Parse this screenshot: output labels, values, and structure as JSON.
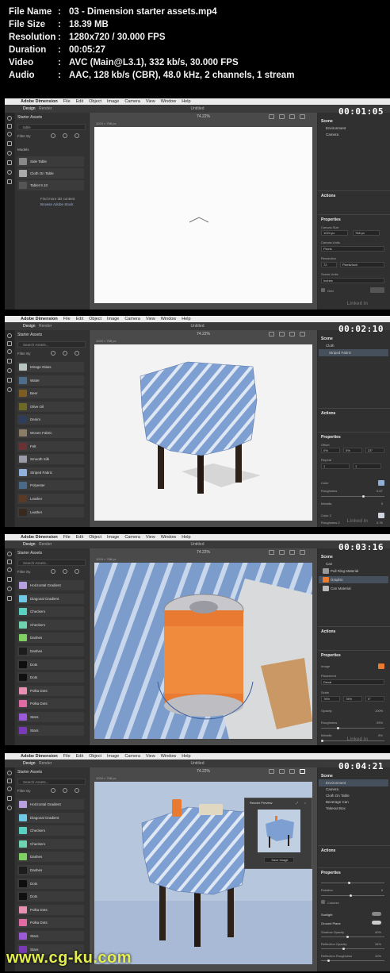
{
  "media_info": [
    {
      "key": "File Name",
      "value": "03 - Dimension starter assets.mp4"
    },
    {
      "key": "File Size",
      "value": "18.39 MB"
    },
    {
      "key": "Resolution",
      "value": "1280x720 / 30.000 FPS"
    },
    {
      "key": "Duration",
      "value": "00:05:27"
    },
    {
      "key": "Video",
      "value": "AVC (Main@L3.1), 332 kb/s, 30.000 FPS"
    },
    {
      "key": "Audio",
      "value": "AAC, 128 kb/s (CBR), 48.0 kHz, 2 channels, 1 stream"
    }
  ],
  "menu": {
    "app": "Adobe Dimension",
    "items": [
      "File",
      "Edit",
      "Object",
      "Image",
      "Camera",
      "View",
      "Window",
      "Help"
    ]
  },
  "tabs": {
    "design": "Design",
    "render": "Render"
  },
  "doc_title": "Untitled",
  "zoom": "74.22%",
  "canvas_size": "1024 × 768 px",
  "watermark": "www.cg-ku.com",
  "frames": [
    {
      "timestamp": "00:01:05",
      "left_title": "Starter Assets",
      "search_value": "table",
      "filter_label": "Filter By",
      "section": "Models",
      "items": [
        {
          "label": "Side Table"
        },
        {
          "label": "Cloth On Table"
        },
        {
          "label": "Tablet 9.10"
        }
      ],
      "find_more": "Find more 3D content",
      "browse": "Browse Adobe Stock",
      "scene": {
        "title": "Scene",
        "items": [
          "Environment",
          "Camera"
        ]
      },
      "actions": "Actions",
      "properties": "Properties",
      "props": {
        "canvas_size": "Canvas Size",
        "w": "1024 px",
        "h": "768 px",
        "canvas_units": "Canvas Units",
        "units_val": "Pixels",
        "resolution": "Resolution",
        "res_val": "72",
        "res_unit": "Pixels/Inch",
        "scene_units": "Scene Units",
        "scene_val": "Inches",
        "grid": "Grid"
      },
      "brand": "Linked in"
    },
    {
      "timestamp": "00:02:10",
      "left_title": "Starter Assets",
      "search_placeholder": "Search Assets...",
      "filter_label": "Filter By",
      "items": [
        {
          "label": "Mirage Glass",
          "color": "#b9c7c2"
        },
        {
          "label": "Water",
          "color": "#4d6e8a"
        },
        {
          "label": "Beer",
          "color": "#7e5d24"
        },
        {
          "label": "Olive Oil",
          "color": "#6e6a26"
        },
        {
          "label": "Denim",
          "color": "#2e3d5e"
        },
        {
          "label": "Woven Fabric",
          "color": "#8a7c66"
        },
        {
          "label": "Felt",
          "color": "#6a3232"
        },
        {
          "label": "Smooth Silk",
          "color": "#9a9aa8"
        },
        {
          "label": "Striped Fabric",
          "color": "#8fb0d8"
        },
        {
          "label": "Polyester",
          "color": "#4a6a8a"
        },
        {
          "label": "Leather",
          "color": "#5a3a24"
        },
        {
          "label": "Leather",
          "color": "#3a2a1e"
        }
      ],
      "scene": {
        "title": "Scene",
        "items": [
          "Cloth",
          "Striped Fabric"
        ]
      },
      "actions": "Actions",
      "properties": "Properties",
      "props": {
        "offset": "Offset",
        "ox": "0%",
        "oy": "0%",
        "angle": "23°",
        "repeat": "Repeat",
        "rx": "1",
        "ry": "1",
        "color": "Color",
        "roughness": "Roughness",
        "roughness_val": "0.67",
        "metallic": "Metallic",
        "metallic_val": "0",
        "color2": "Color 2",
        "roughness2": "Roughness 2",
        "roughness2_val": "0.76",
        "metallic2": "Metallic 2"
      },
      "brand": "Linked in"
    },
    {
      "timestamp": "00:03:16",
      "left_title": "Starter Assets",
      "search_placeholder": "Search Assets...",
      "filter_label": "Filter By",
      "items": [
        {
          "label": "Horizontal Gradient",
          "color": "#b79fe0"
        },
        {
          "label": "Diagonal Gradient",
          "color": "#6fc9e6"
        },
        {
          "label": "Checkers",
          "color": "#59d0c0"
        },
        {
          "label": "Checkers",
          "color": "#6ed4b0"
        },
        {
          "label": "Dashes",
          "color": "#7fcf62"
        },
        {
          "label": "Dashes",
          "color": "#1c1c1c"
        },
        {
          "label": "Dots",
          "color": "#0e0e0e"
        },
        {
          "label": "Dots",
          "color": "#101010"
        },
        {
          "label": "Polka Dots",
          "color": "#e890b4"
        },
        {
          "label": "Polka Dots",
          "color": "#e26aa4"
        },
        {
          "label": "Stars",
          "color": "#9c5ad8"
        },
        {
          "label": "Stars",
          "color": "#7a3ab8"
        }
      ],
      "scene": {
        "title": "Scene",
        "items": [
          "Can",
          "Pull Ring Material",
          "Graphic",
          "Can Material"
        ]
      },
      "actions": "Actions",
      "properties": "Properties",
      "props": {
        "image": "Image",
        "placement": "Placement",
        "placement_val": "Decal",
        "scale": "Scale",
        "sx": "78%",
        "sy": "78%",
        "angle": "0°",
        "opacity": "Opacity",
        "opacity_val": "100%",
        "roughness": "Roughness",
        "roughness_val": "25%",
        "metallic": "Metallic",
        "metallic_val": "0%"
      },
      "brand": "Linked in"
    },
    {
      "timestamp": "00:04:21",
      "left_title": "Starter Assets",
      "search_placeholder": "Search Assets...",
      "filter_label": "Filter By",
      "items": [
        {
          "label": "Horizontal Gradient",
          "color": "#b79fe0"
        },
        {
          "label": "Diagonal Gradient",
          "color": "#6fc9e6"
        },
        {
          "label": "Checkers",
          "color": "#59d0c0"
        },
        {
          "label": "Checkers",
          "color": "#6ed4b0"
        },
        {
          "label": "Dashes",
          "color": "#7fcf62"
        },
        {
          "label": "Dashes",
          "color": "#1c1c1c"
        },
        {
          "label": "Dots",
          "color": "#0e0e0e"
        },
        {
          "label": "Dots",
          "color": "#101010"
        },
        {
          "label": "Polka Dots",
          "color": "#e890b4"
        },
        {
          "label": "Polka Dots",
          "color": "#e26aa4"
        },
        {
          "label": "Stars",
          "color": "#9c5ad8"
        },
        {
          "label": "Stars",
          "color": "#7a3ab8"
        }
      ],
      "preview_title": "Render Preview",
      "save_image": "Save Image",
      "scene": {
        "title": "Scene",
        "items": [
          "Environment",
          "Camera",
          "Cloth On Table",
          "Beverage Can",
          "Takeout Box"
        ]
      },
      "actions": "Actions",
      "properties": "Properties",
      "props": {
        "rotation": "Rotation",
        "rotation_val": "0",
        "colorize": "Colorize",
        "sunlight": "Sunlight",
        "ground_plane": "Ground Plane",
        "shadow_opacity": "Shadow Opacity",
        "shadow_val": "40%",
        "reflection_opacity": "Reflection Opacity",
        "reflection_val": "34%",
        "reflection_roughness": "Reflection Roughness",
        "reflection_rough_val": "10%"
      },
      "brand": "Linked in"
    }
  ]
}
